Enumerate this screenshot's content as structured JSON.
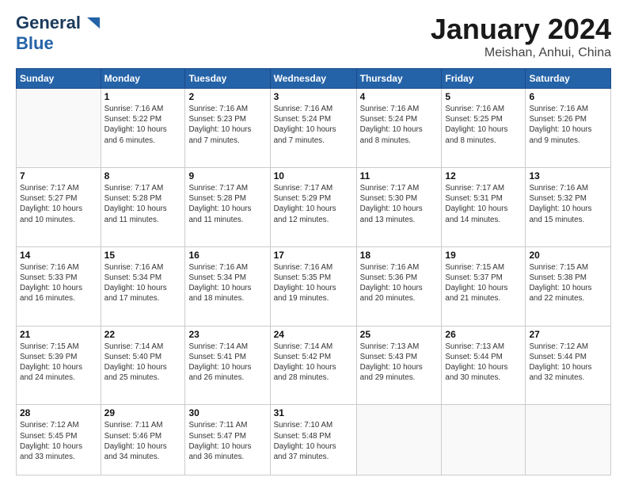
{
  "header": {
    "logo_line1": "General",
    "logo_line2": "Blue",
    "title": "January 2024",
    "subtitle": "Meishan, Anhui, China"
  },
  "days_of_week": [
    "Sunday",
    "Monday",
    "Tuesday",
    "Wednesday",
    "Thursday",
    "Friday",
    "Saturday"
  ],
  "weeks": [
    [
      {
        "day": "",
        "info": ""
      },
      {
        "day": "1",
        "info": "Sunrise: 7:16 AM\nSunset: 5:22 PM\nDaylight: 10 hours\nand 6 minutes."
      },
      {
        "day": "2",
        "info": "Sunrise: 7:16 AM\nSunset: 5:23 PM\nDaylight: 10 hours\nand 7 minutes."
      },
      {
        "day": "3",
        "info": "Sunrise: 7:16 AM\nSunset: 5:24 PM\nDaylight: 10 hours\nand 7 minutes."
      },
      {
        "day": "4",
        "info": "Sunrise: 7:16 AM\nSunset: 5:24 PM\nDaylight: 10 hours\nand 8 minutes."
      },
      {
        "day": "5",
        "info": "Sunrise: 7:16 AM\nSunset: 5:25 PM\nDaylight: 10 hours\nand 8 minutes."
      },
      {
        "day": "6",
        "info": "Sunrise: 7:16 AM\nSunset: 5:26 PM\nDaylight: 10 hours\nand 9 minutes."
      }
    ],
    [
      {
        "day": "7",
        "info": "Sunrise: 7:17 AM\nSunset: 5:27 PM\nDaylight: 10 hours\nand 10 minutes."
      },
      {
        "day": "8",
        "info": "Sunrise: 7:17 AM\nSunset: 5:28 PM\nDaylight: 10 hours\nand 11 minutes."
      },
      {
        "day": "9",
        "info": "Sunrise: 7:17 AM\nSunset: 5:28 PM\nDaylight: 10 hours\nand 11 minutes."
      },
      {
        "day": "10",
        "info": "Sunrise: 7:17 AM\nSunset: 5:29 PM\nDaylight: 10 hours\nand 12 minutes."
      },
      {
        "day": "11",
        "info": "Sunrise: 7:17 AM\nSunset: 5:30 PM\nDaylight: 10 hours\nand 13 minutes."
      },
      {
        "day": "12",
        "info": "Sunrise: 7:17 AM\nSunset: 5:31 PM\nDaylight: 10 hours\nand 14 minutes."
      },
      {
        "day": "13",
        "info": "Sunrise: 7:16 AM\nSunset: 5:32 PM\nDaylight: 10 hours\nand 15 minutes."
      }
    ],
    [
      {
        "day": "14",
        "info": "Sunrise: 7:16 AM\nSunset: 5:33 PM\nDaylight: 10 hours\nand 16 minutes."
      },
      {
        "day": "15",
        "info": "Sunrise: 7:16 AM\nSunset: 5:34 PM\nDaylight: 10 hours\nand 17 minutes."
      },
      {
        "day": "16",
        "info": "Sunrise: 7:16 AM\nSunset: 5:34 PM\nDaylight: 10 hours\nand 18 minutes."
      },
      {
        "day": "17",
        "info": "Sunrise: 7:16 AM\nSunset: 5:35 PM\nDaylight: 10 hours\nand 19 minutes."
      },
      {
        "day": "18",
        "info": "Sunrise: 7:16 AM\nSunset: 5:36 PM\nDaylight: 10 hours\nand 20 minutes."
      },
      {
        "day": "19",
        "info": "Sunrise: 7:15 AM\nSunset: 5:37 PM\nDaylight: 10 hours\nand 21 minutes."
      },
      {
        "day": "20",
        "info": "Sunrise: 7:15 AM\nSunset: 5:38 PM\nDaylight: 10 hours\nand 22 minutes."
      }
    ],
    [
      {
        "day": "21",
        "info": "Sunrise: 7:15 AM\nSunset: 5:39 PM\nDaylight: 10 hours\nand 24 minutes."
      },
      {
        "day": "22",
        "info": "Sunrise: 7:14 AM\nSunset: 5:40 PM\nDaylight: 10 hours\nand 25 minutes."
      },
      {
        "day": "23",
        "info": "Sunrise: 7:14 AM\nSunset: 5:41 PM\nDaylight: 10 hours\nand 26 minutes."
      },
      {
        "day": "24",
        "info": "Sunrise: 7:14 AM\nSunset: 5:42 PM\nDaylight: 10 hours\nand 28 minutes."
      },
      {
        "day": "25",
        "info": "Sunrise: 7:13 AM\nSunset: 5:43 PM\nDaylight: 10 hours\nand 29 minutes."
      },
      {
        "day": "26",
        "info": "Sunrise: 7:13 AM\nSunset: 5:44 PM\nDaylight: 10 hours\nand 30 minutes."
      },
      {
        "day": "27",
        "info": "Sunrise: 7:12 AM\nSunset: 5:44 PM\nDaylight: 10 hours\nand 32 minutes."
      }
    ],
    [
      {
        "day": "28",
        "info": "Sunrise: 7:12 AM\nSunset: 5:45 PM\nDaylight: 10 hours\nand 33 minutes."
      },
      {
        "day": "29",
        "info": "Sunrise: 7:11 AM\nSunset: 5:46 PM\nDaylight: 10 hours\nand 34 minutes."
      },
      {
        "day": "30",
        "info": "Sunrise: 7:11 AM\nSunset: 5:47 PM\nDaylight: 10 hours\nand 36 minutes."
      },
      {
        "day": "31",
        "info": "Sunrise: 7:10 AM\nSunset: 5:48 PM\nDaylight: 10 hours\nand 37 minutes."
      },
      {
        "day": "",
        "info": ""
      },
      {
        "day": "",
        "info": ""
      },
      {
        "day": "",
        "info": ""
      }
    ]
  ]
}
